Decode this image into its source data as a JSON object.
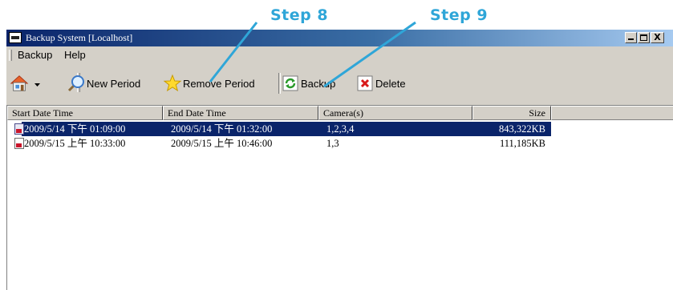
{
  "annotations": {
    "step8": "Step 8",
    "step9": "Step 9"
  },
  "window": {
    "title": "Backup System [Localhost]",
    "controls": {
      "minimize": "_",
      "maximize": "□",
      "close": "X"
    }
  },
  "menu": {
    "items": [
      "Backup",
      "Help"
    ]
  },
  "toolbar": {
    "new_period": "New Period",
    "remove_period": "Remove Period",
    "backup": "Backup",
    "delete": "Delete"
  },
  "list": {
    "columns": [
      "Start Date Time",
      "End Date Time",
      "Camera(s)",
      "Size"
    ],
    "rows": [
      {
        "start": "2009/5/14 下午 01:09:00",
        "end": "2009/5/14 下午 01:32:00",
        "cameras": "1,2,3,4",
        "size": "843,322KB",
        "selected": true
      },
      {
        "start": "2009/5/15 上午 10:33:00",
        "end": "2009/5/15 上午 10:46:00",
        "cameras": "1,3",
        "size": "111,185KB",
        "selected": false
      }
    ]
  },
  "colors": {
    "title_start": "#0a246a",
    "title_end": "#a6caf0",
    "selection": "#0a246a",
    "annotation": "#2fa6d8",
    "chrome": "#d4d0c8"
  },
  "icons": [
    "home-icon",
    "dropdown-arrow-icon",
    "magnifier-icon",
    "star-icon",
    "refresh-icon",
    "delete-x-icon",
    "file-icon"
  ]
}
